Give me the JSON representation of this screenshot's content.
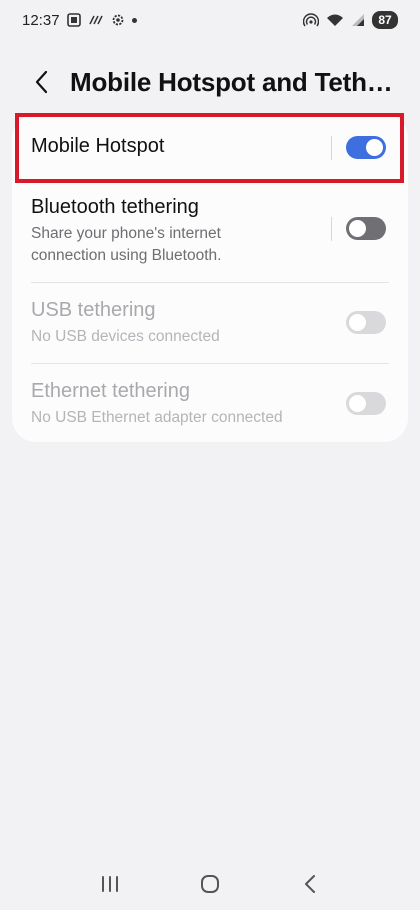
{
  "status_bar": {
    "time": "12:37",
    "battery": "87",
    "icons": [
      "screenshot-icon",
      "wifi-calling-icon",
      "settings-icon",
      "dot-icon",
      "hotspot-icon",
      "wifi-icon",
      "signal-icon"
    ]
  },
  "header": {
    "title": "Mobile Hotspot and Tethering"
  },
  "settings": {
    "mobile_hotspot": {
      "title": "Mobile Hotspot",
      "enabled": true
    },
    "bluetooth_tethering": {
      "title": "Bluetooth tethering",
      "subtitle_line1": "Share your phone's internet",
      "subtitle_line2": "connection using Bluetooth.",
      "enabled": false
    },
    "usb_tethering": {
      "title": "USB tethering",
      "subtitle": "No USB devices connected",
      "enabled": false,
      "disabled": true
    },
    "ethernet_tethering": {
      "title": "Ethernet tethering",
      "subtitle": "No USB Ethernet adapter connected",
      "enabled": false,
      "disabled": true
    }
  },
  "colors": {
    "accent": "#3e6fe0",
    "highlight": "#d7192a",
    "background": "#f2f2f5",
    "card": "#fcfcfd"
  },
  "nav_bar": {
    "buttons": [
      "recents-icon",
      "home-icon",
      "back-icon"
    ]
  }
}
